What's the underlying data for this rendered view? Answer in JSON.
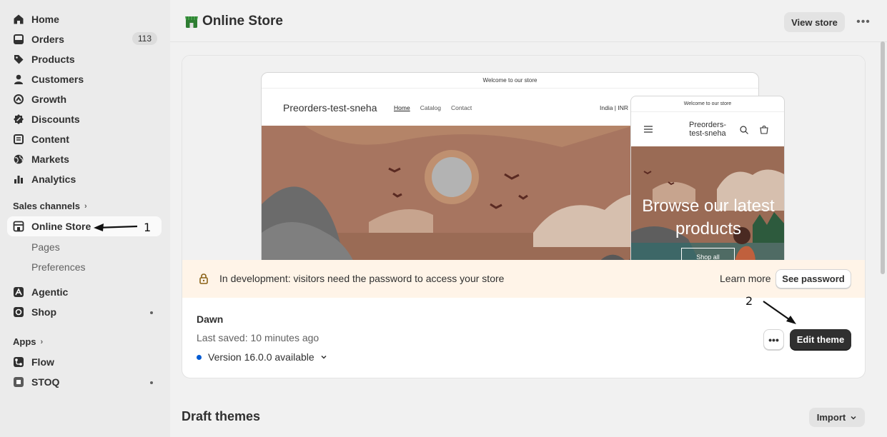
{
  "sidebar": {
    "items": [
      {
        "label": "Home",
        "icon": "home-icon"
      },
      {
        "label": "Orders",
        "icon": "orders-icon",
        "badge": "113"
      },
      {
        "label": "Products",
        "icon": "tag-icon"
      },
      {
        "label": "Customers",
        "icon": "person-icon"
      },
      {
        "label": "Growth",
        "icon": "growth-icon"
      },
      {
        "label": "Discounts",
        "icon": "discount-icon"
      },
      {
        "label": "Content",
        "icon": "content-icon"
      },
      {
        "label": "Markets",
        "icon": "globe-icon"
      },
      {
        "label": "Analytics",
        "icon": "chart-icon"
      }
    ],
    "sales_channels_title": "Sales channels",
    "online_store": {
      "label": "Online Store",
      "icon": "store-icon"
    },
    "online_store_sub": [
      "Pages",
      "Preferences"
    ],
    "channels": [
      {
        "label": "Agentic",
        "icon": "agentic-icon"
      },
      {
        "label": "Shop",
        "icon": "shop-icon"
      }
    ],
    "apps_title": "Apps",
    "apps": [
      {
        "label": "Flow",
        "icon": "flow-icon"
      },
      {
        "label": "STOQ",
        "icon": "stoq-icon"
      }
    ]
  },
  "header": {
    "title": "Online Store",
    "view_store": "View store",
    "more": "•••"
  },
  "preview": {
    "desktop_announcement": "Welcome to our store",
    "desktop_brand": "Preorders-test-sneha",
    "desktop_nav": [
      "Home",
      "Catalog",
      "Contact"
    ],
    "desktop_region": "India | INR",
    "mobile_announcement": "Welcome to our store",
    "mobile_brand": "Preorders-test-sneha",
    "mobile_hero_text": "Browse our latest products",
    "mobile_shop_button": "Shop all"
  },
  "banner": {
    "text": "In development: visitors need the password to access your store",
    "learn_more": "Learn more",
    "see_password": "See password"
  },
  "theme": {
    "name": "Dawn",
    "last_saved": "Last saved: 10 minutes ago",
    "version": "Version 16.0.0 available",
    "more": "•••",
    "edit_theme": "Edit theme"
  },
  "draft": {
    "title": "Draft themes",
    "import": "Import"
  },
  "annotations": {
    "one": "1",
    "two": "2"
  },
  "colors": {
    "primary_button": "#303030",
    "banner_bg": "#fff4e8",
    "version_dot": "#005bd3"
  }
}
